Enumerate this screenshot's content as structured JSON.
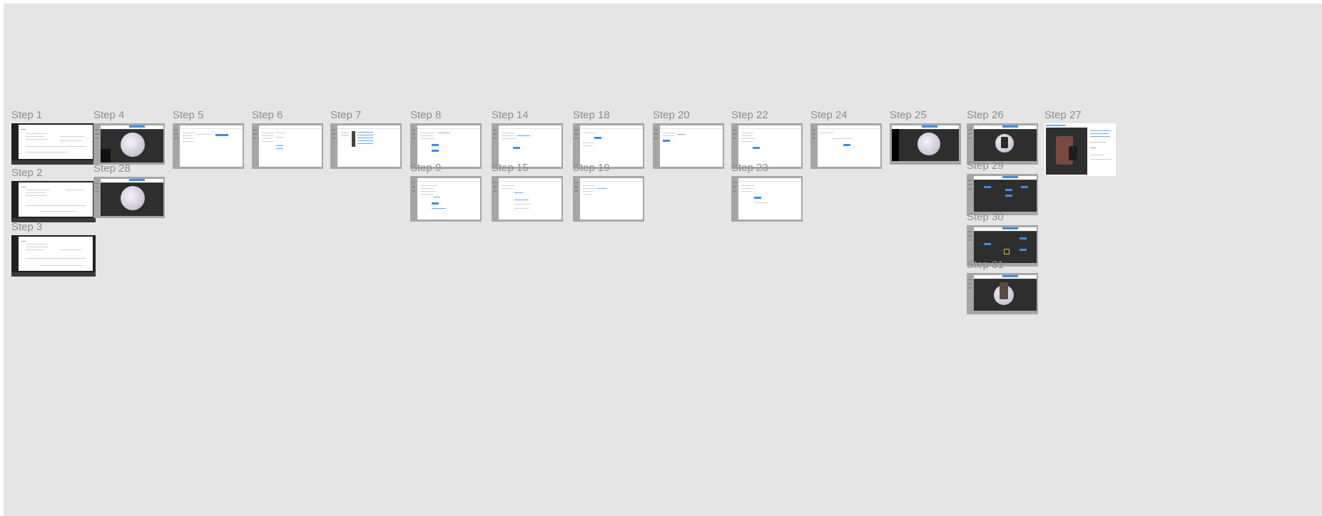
{
  "steps": {
    "s1": "Step 1",
    "s2": "Step 2",
    "s3": "Step 3",
    "s4": "Step 4",
    "s28": "Step 28",
    "s5": "Step 5",
    "s6": "Step 6",
    "s7": "Step 7",
    "s8": "Step 8",
    "s9": "Step 9",
    "s14": "Step 14",
    "s15": "Step 15",
    "s18": "Step 18",
    "s19": "Step 19",
    "s20": "Step 20",
    "s22": "Step 22",
    "s23": "Step 23",
    "s24": "Step 24",
    "s25": "Step 25",
    "s26": "Step 26",
    "s29": "Step 29",
    "s30": "Step 30",
    "s31": "Step 31",
    "s27": "Step 27"
  },
  "colors": {
    "canvas": "#e5e5e5",
    "frame_border": "#a6a6a6",
    "accent": "#3b8ee6",
    "label": "#8c8c8c"
  }
}
